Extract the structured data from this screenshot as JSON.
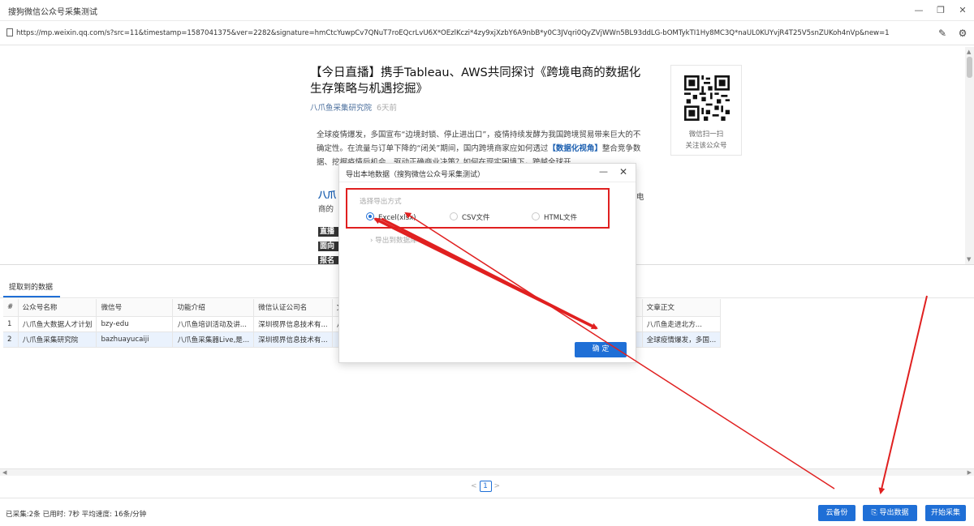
{
  "window": {
    "title": "搜狗微信公众号采集测试",
    "minimize": "—",
    "restore": "❐",
    "close": "✕"
  },
  "urlbar": {
    "url": "https://mp.weixin.qq.com/s?src=11&timestamp=1587041375&ver=2282&signature=hmCtcYuwpCv7QNuT7roEQcrLvU6X*OEzlKczi*4zy9xjXzbY6A9nbB*y0C3JVqri0QyZVjWWn5BL93ddLG-bOMTykTI1Hy8MC3Q*naUL0KUYvjR4T25V5snZUKoh4nVp&new=1",
    "edit_icon": "✎",
    "settings_icon": "⚙"
  },
  "article": {
    "title": "【今日直播】携手Tableau、AWS共同探讨《跨境电商的数据化生存策略与机遇挖掘》",
    "author": "八爪鱼采集研究院",
    "time": "6天前",
    "body_1": "全球疫情爆发，多国宣布“边境封锁、停止进出口”，疫情持续发酵为我国跨境贸易带来巨大的不确定性。在流量与订单下降的“闭关”期间，国内跨境商家应如何透过",
    "body_bold_1": "【数据化视角】",
    "body_2": "整合竞争数据、挖掘疫情后机会、驱动正确商业决策？如何在现实困境下，跨越全球开",
    "subhead": "八爪",
    "subtext": "商的",
    "extra": "电",
    "blocks": [
      "直播",
      "面向",
      "报名"
    ],
    "qr_caption_1": "微信扫一扫",
    "qr_caption_2": "关注该公众号"
  },
  "scroll": {
    "up": "▲",
    "down": "▼",
    "left": "◀",
    "right": "▶"
  },
  "data_panel": {
    "tab_label": "提取到的数据",
    "columns": [
      "#",
      "公众号名称",
      "微信号",
      "功能介绍",
      "微信认证公司名",
      "文",
      "文章正文"
    ],
    "rows": [
      [
        "1",
        "八爪鱼大数据人才计划",
        "bzy-edu",
        "八爪鱼培训活动及讲...",
        "深圳视界信息技术有...",
        "八/",
        "八爪鱼走进北方..."
      ],
      [
        "2",
        "八爪鱼采集研究院",
        "bazhuayucaiji",
        "八爪鱼采集器Live,是...",
        "深圳视界信息技术有...",
        "【4",
        "全球疫情爆发，多国..."
      ]
    ]
  },
  "pager": {
    "prev": "<",
    "page": "1",
    "next": ">"
  },
  "status": "已采集:2条 已用时: 7秒 平均速度: 16条/分钟",
  "buttons": {
    "cloud_backup": "云备份",
    "export_data": "导出数据",
    "export_icon": "⎘",
    "start_collect": "开始采集"
  },
  "modal": {
    "title": "导出本地数据（搜狗微信公众号采集测试）",
    "minimize": "—",
    "close": "✕",
    "section_label": "选择导出方式",
    "options": [
      "Excel(xlsx)",
      "CSV文件",
      "HTML文件"
    ],
    "selected": "Excel(xlsx)",
    "expand_label": "导出到数据库",
    "expand_chevron": "›",
    "ok_button": "确 定"
  },
  "colors": {
    "accent": "#1f6fd6",
    "annotation_red": "#e02020"
  }
}
